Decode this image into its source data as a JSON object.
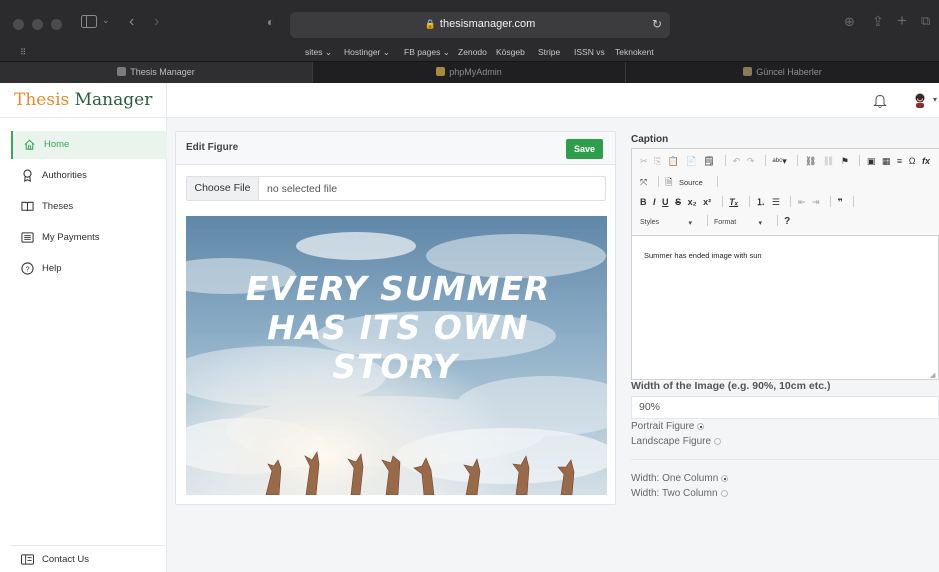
{
  "browser": {
    "url": "thesismanager.com",
    "favorites": [
      "sites ⌄",
      "Hostinger ⌄",
      "FB pages ⌄",
      "Zenodo",
      "Kösgeb",
      "Stripe",
      "ISSN vs",
      "Teknokent"
    ],
    "tabs": [
      {
        "label": "Thesis Manager",
        "active": true
      },
      {
        "label": "phpMyAdmin",
        "active": false
      },
      {
        "label": "Güncel Haberler",
        "active": false
      }
    ]
  },
  "app": {
    "brand_part1": "Thesis",
    "brand_part2": " Manager",
    "nav": [
      {
        "label": "Home",
        "icon": "home-icon",
        "active": true
      },
      {
        "label": "Authorities",
        "icon": "badge-icon",
        "active": false
      },
      {
        "label": "Theses",
        "icon": "book-icon",
        "active": false
      },
      {
        "label": "My Payments",
        "icon": "list-icon",
        "active": false
      },
      {
        "label": "Help",
        "icon": "help-icon",
        "active": false
      }
    ],
    "contact_label": "Contact Us",
    "accent_color": "#3aa757",
    "brand_color": "#e9892b"
  },
  "edit_figure": {
    "title": "Edit Figure",
    "save_label": "Save",
    "choose_file_label": "Choose File",
    "file_status": "no selected file",
    "image_text": [
      "EVERY SUMMER",
      "HAS ITS OWN",
      "STORY"
    ]
  },
  "caption": {
    "label": "Caption",
    "source_label": "Source",
    "styles_label": "Styles",
    "format_label": "Format",
    "body_text": "Summer has ended image with sun"
  },
  "image_options": {
    "width_label": "Width of the Image (e.g. 90%, 10cm etc.)",
    "width_value": "90%",
    "portrait_label": "Portrait Figure",
    "landscape_label": "Landscape Figure",
    "one_column_label": "Width: One Column",
    "two_column_label": "Width: Two Column",
    "portrait_selected": true,
    "one_column_selected": true
  }
}
